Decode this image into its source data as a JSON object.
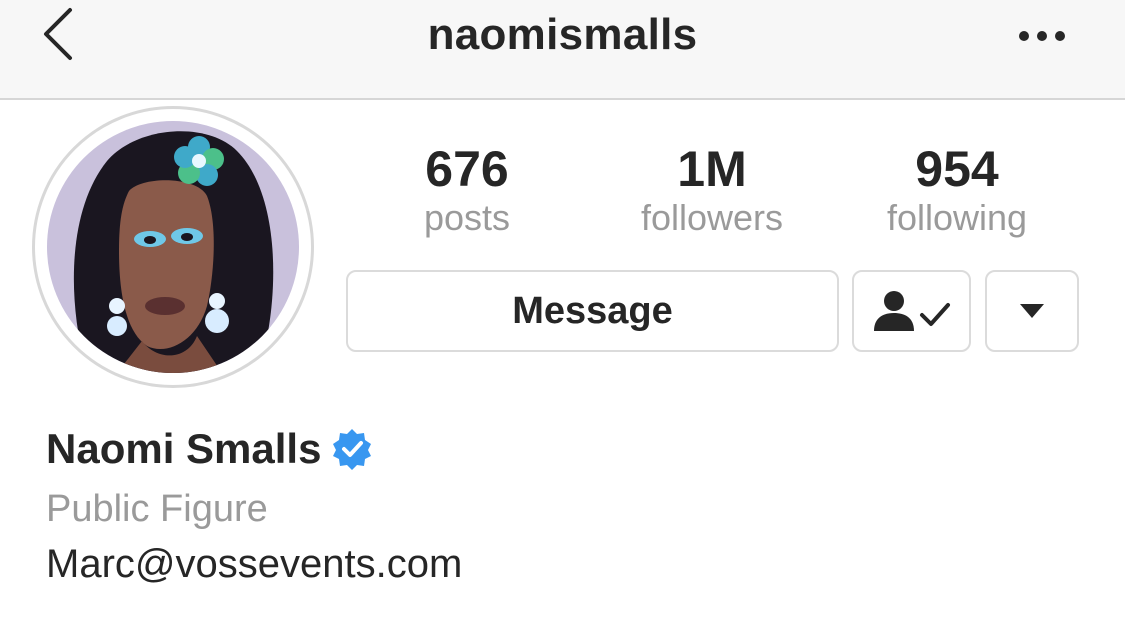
{
  "header": {
    "username": "naomismalls",
    "back_icon": "chevron-left-icon",
    "more_icon": "more-horizontal-icon"
  },
  "profile": {
    "avatar_icon": "profile-photo",
    "stats": [
      {
        "value": "676",
        "label": "posts"
      },
      {
        "value": "1M",
        "label": "followers"
      },
      {
        "value": "954",
        "label": "following"
      }
    ],
    "actions": {
      "message_label": "Message",
      "following_icon": "person-check-icon",
      "dropdown_icon": "caret-down-icon"
    },
    "name": "Naomi Smalls",
    "verified_icon": "verified-badge-icon",
    "category": "Public Figure",
    "contact": "Marc@vossevents.com"
  },
  "colors": {
    "text": "#262626",
    "secondary_text": "#9a9a9a",
    "border": "#dbdbdb",
    "verified": "#3897f0",
    "header_bg": "#f7f7f7"
  }
}
